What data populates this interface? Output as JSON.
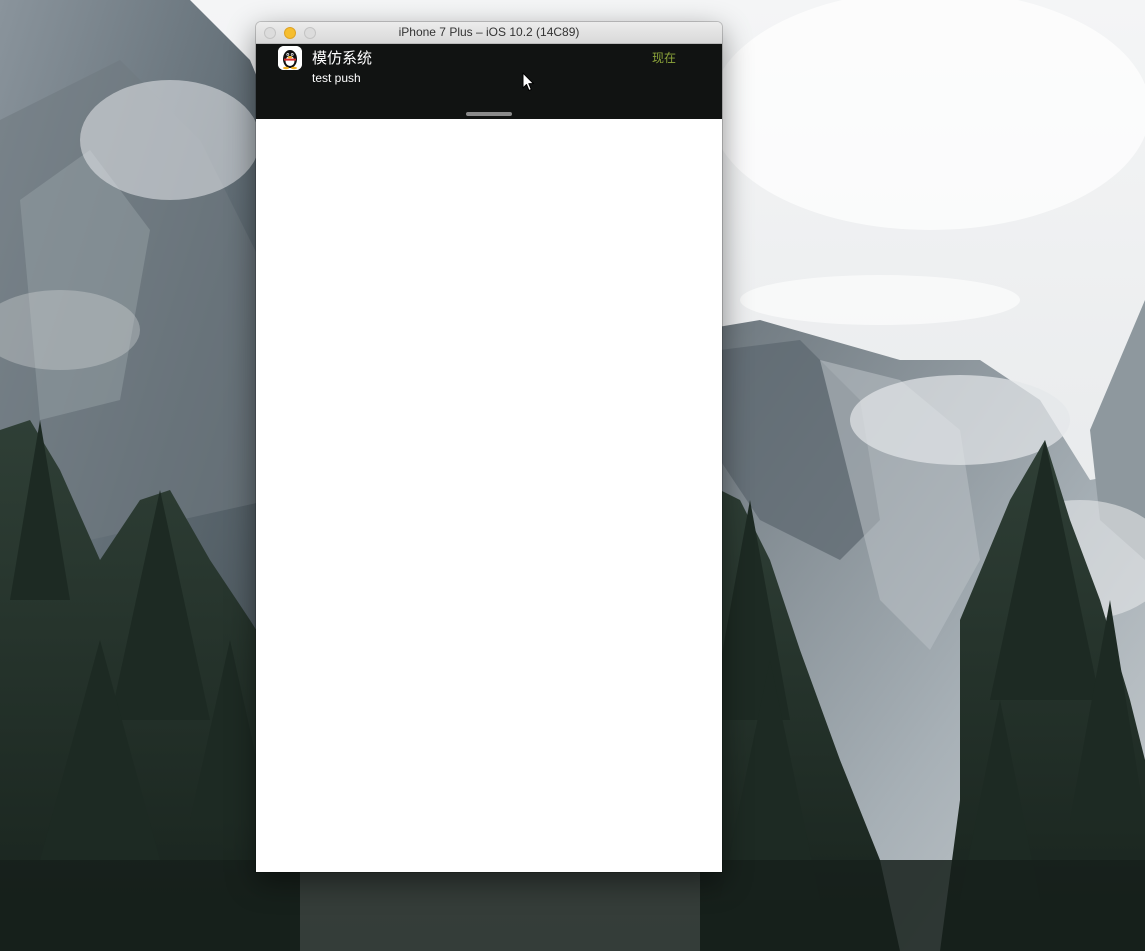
{
  "window": {
    "title": "iPhone 7 Plus – iOS 10.2 (14C89)"
  },
  "notification": {
    "app_name": "模仿系统",
    "time": "现在",
    "message": "test push",
    "icon": "qq-penguin-icon"
  },
  "colors": {
    "banner_background": "#111312",
    "time_text": "#8da43a",
    "minimize_button": "#f6be2f"
  }
}
